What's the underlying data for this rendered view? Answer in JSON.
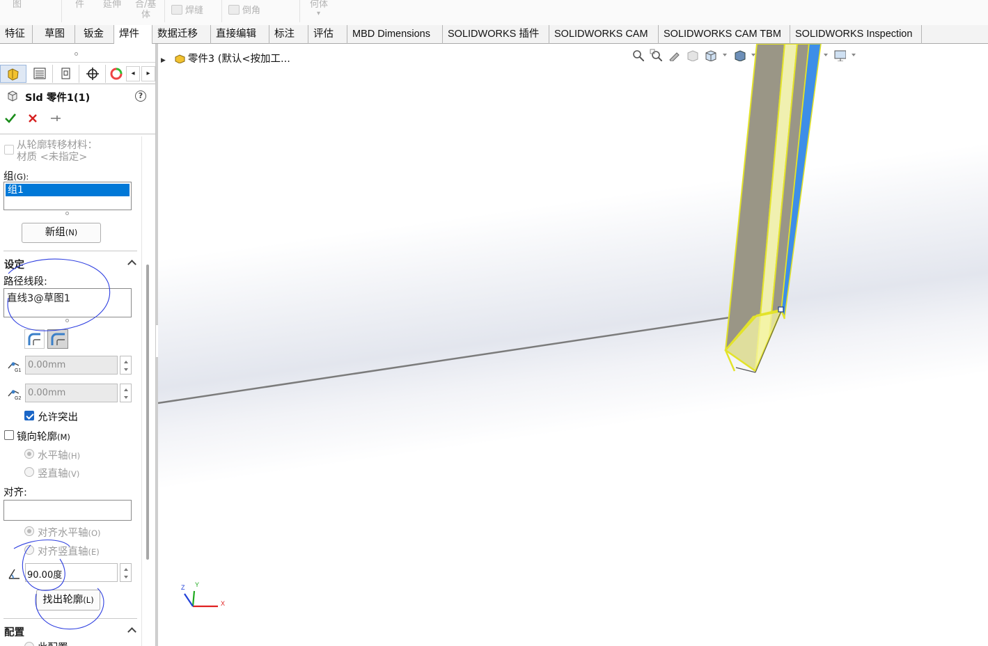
{
  "ribbon": {
    "items": [
      "图",
      "件",
      "延伸",
      "合/基",
      "体",
      "焊缝",
      "倒角",
      "何体"
    ]
  },
  "tabs": [
    {
      "label": "特征"
    },
    {
      "label": "草图"
    },
    {
      "label": "钣金"
    },
    {
      "label": "焊件"
    },
    {
      "label": "数据迁移"
    },
    {
      "label": "直接编辑"
    },
    {
      "label": "标注"
    },
    {
      "label": "评估"
    },
    {
      "label": "MBD Dimensions"
    },
    {
      "label": "SOLIDWORKS 插件"
    },
    {
      "label": "SOLIDWORKS CAM"
    },
    {
      "label": "SOLIDWORKS CAM TBM"
    },
    {
      "label": "SOLIDWORKS Inspection"
    }
  ],
  "active_tab": "焊件",
  "pm": {
    "title": "Sld 零件1(1)",
    "transfer_material_label": "从轮廓转移材料：",
    "material_label": "材质 <未指定>",
    "group_label": "组",
    "group_shortcut": "(G):",
    "group_items": [
      "组1"
    ],
    "new_group_label": "新组",
    "new_group_shortcut": "(N)",
    "settings_title": "设定",
    "path_segment_label": "路径线段:",
    "path_segment_value": "直线3@草图1",
    "offset1_value": "0.00mm",
    "offset2_value": "0.00mm",
    "allow_protrusion_label": "允许突出",
    "mirror_profile_label": "镜向轮廓",
    "mirror_shortcut": "(M)",
    "horizontal_axis_label": "水平轴",
    "horizontal_shortcut": "(H)",
    "vertical_axis_label": "竖直轴",
    "vertical_shortcut": "(V)",
    "align_label": "对齐:",
    "align_horizontal_label": "对齐水平轴",
    "align_horizontal_shortcut": "(O)",
    "align_vertical_label": "对齐竖直轴",
    "align_vertical_shortcut": "(E)",
    "angle_value": "90.00度",
    "locate_profile_label": "找出轮廓",
    "locate_profile_shortcut": "(L)",
    "config_title": "配置",
    "config_option_label": "此配置"
  },
  "viewport": {
    "tree_label": "零件3 (默认<按加工..."
  },
  "triad": {
    "x": "X",
    "y": "Y",
    "z": "Z"
  },
  "colors": {
    "accent_blue": "#0078d7",
    "check_green": "#1a8c1a",
    "cancel_red": "#d62020",
    "selection_yellow": "#f5f53d",
    "edge_blue": "#3d8ee8"
  }
}
